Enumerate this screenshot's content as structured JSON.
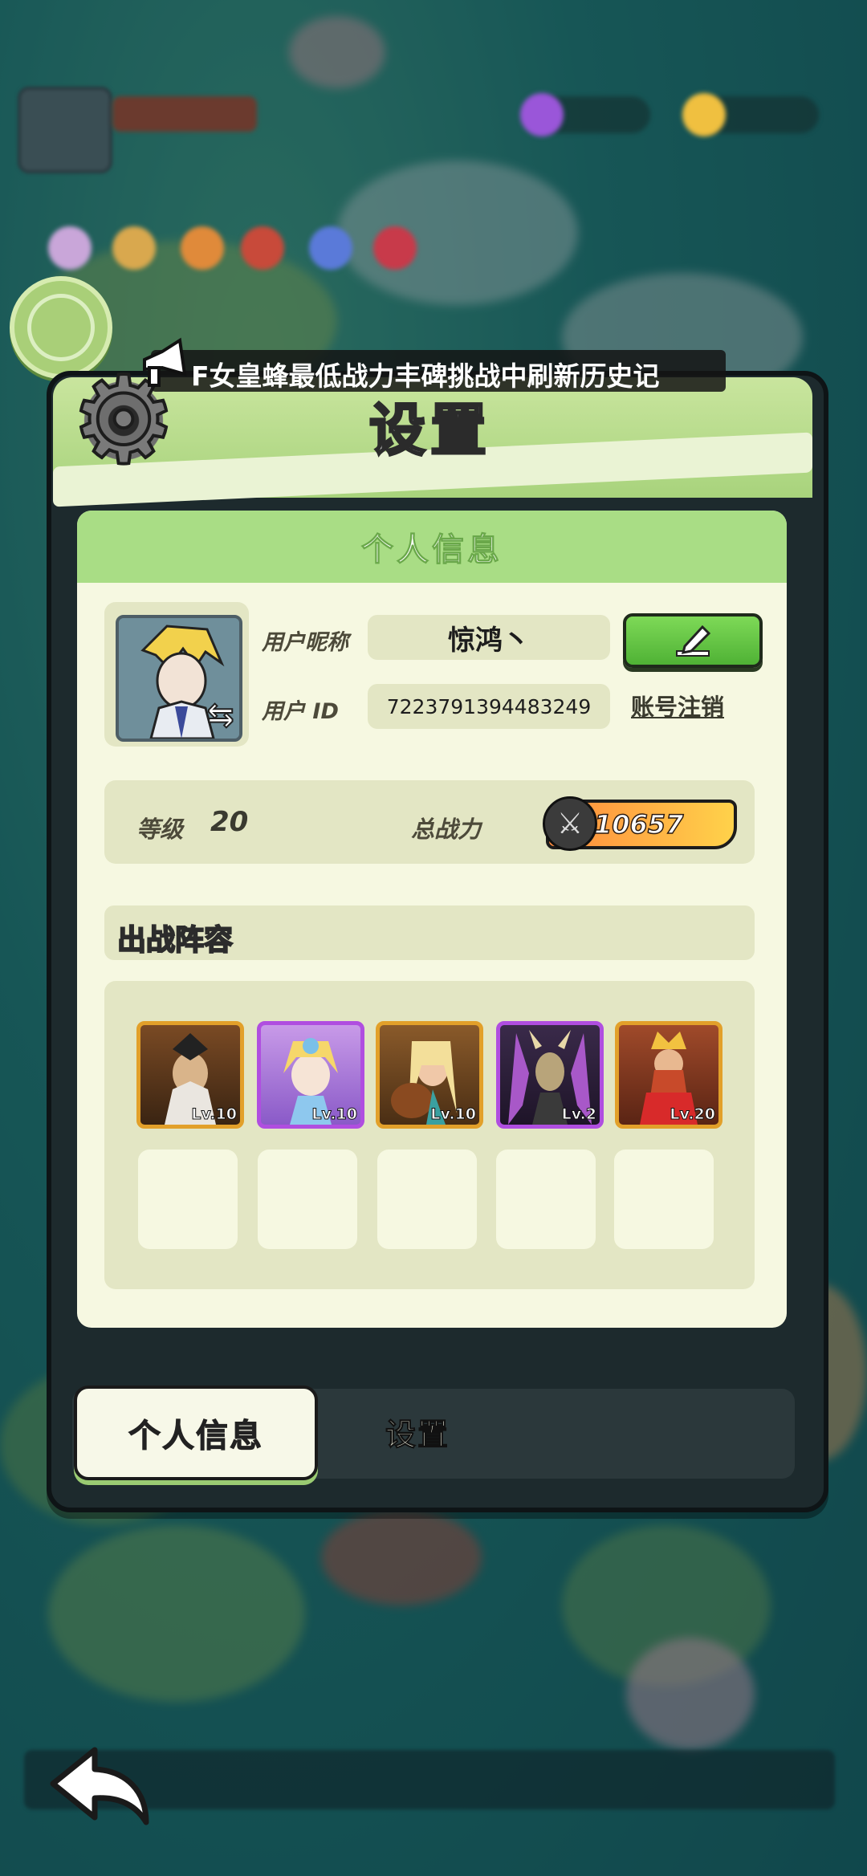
{
  "announcement": {
    "text": "F女皇蜂最低战力丰碑挑战中刷新历史记"
  },
  "panel": {
    "title": "设置"
  },
  "card": {
    "header": "个人信息"
  },
  "profile": {
    "nickname_label": "用户昵称",
    "nickname_value": "惊鸿丶",
    "id_label": "用户  ID",
    "id_value": "7223791394483249",
    "logout_label": "账号注销",
    "edit_icon": "pencil-icon"
  },
  "stats": {
    "level_label": "等级",
    "level_value": "20",
    "power_label": "总战力",
    "power_value": "10657"
  },
  "lineup": {
    "title": "出战阵容",
    "heroes": [
      {
        "level": "Lv.10",
        "frame": "gold"
      },
      {
        "level": "Lv.10",
        "frame": "purple"
      },
      {
        "level": "Lv.10",
        "frame": "gold"
      },
      {
        "level": "Lv.2",
        "frame": "purple"
      },
      {
        "level": "Lv.20",
        "frame": "gold"
      }
    ],
    "empty_slots": 5
  },
  "tabs": {
    "active": "个人信息",
    "other": "设置"
  },
  "colors": {
    "header_green": "#a8d37c",
    "card_bg": "#f6f8e1",
    "edit_green": "#4fb235",
    "gold_frame": "#e2a02a",
    "purple_frame": "#b04ee0",
    "power_orange": "#ff8a3d"
  }
}
